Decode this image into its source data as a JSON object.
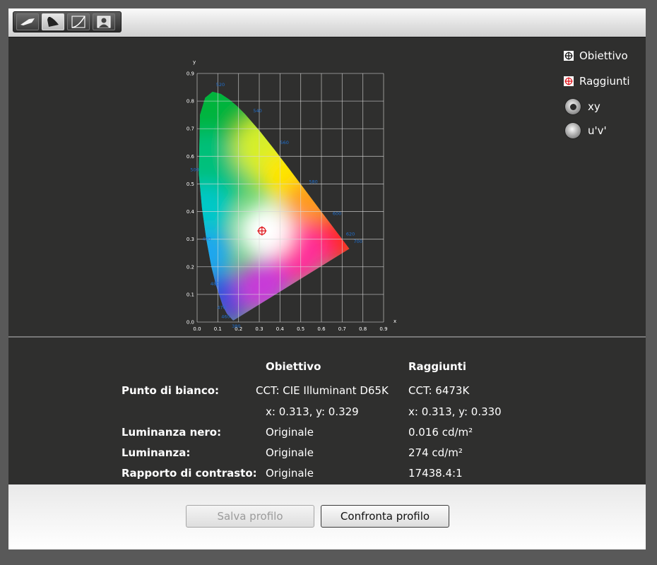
{
  "toolbar": {
    "tools": [
      {
        "name": "calibration-tool-icon",
        "active": false
      },
      {
        "name": "gamut-chart-icon",
        "active": true
      },
      {
        "name": "curve-icon",
        "active": false
      },
      {
        "name": "profile-user-icon",
        "active": false
      }
    ]
  },
  "legend": {
    "target_label": "Obiettivo",
    "achieved_label": "Raggiunti",
    "xy_label": "xy",
    "uv_label": "u'v'",
    "selected_mode": "xy",
    "achieved_color": "#e0161c"
  },
  "chart_data": {
    "type": "scatter",
    "title": "",
    "xlabel": "x",
    "ylabel": "y",
    "xlim": [
      0,
      0.9
    ],
    "ylim": [
      0,
      0.9
    ],
    "grid": true,
    "x_ticks": [
      "0.0",
      "0.1",
      "0.2",
      "0.3",
      "0.4",
      "0.5",
      "0.6",
      "0.7",
      "0.8",
      "0.9"
    ],
    "y_ticks": [
      "0.0",
      "0.1",
      "0.2",
      "0.3",
      "0.4",
      "0.5",
      "0.6",
      "0.7",
      "0.8",
      "0.9"
    ],
    "locus": [
      [
        0.1741,
        0.005
      ],
      [
        0.144,
        0.0297
      ],
      [
        0.1241,
        0.0578
      ],
      [
        0.0913,
        0.1327
      ],
      [
        0.0687,
        0.2007
      ],
      [
        0.0454,
        0.295
      ],
      [
        0.0235,
        0.4127
      ],
      [
        0.0082,
        0.5384
      ],
      [
        0.0139,
        0.7502
      ],
      [
        0.0389,
        0.812
      ],
      [
        0.0743,
        0.8338
      ],
      [
        0.1142,
        0.8262
      ],
      [
        0.1547,
        0.8059
      ],
      [
        0.1929,
        0.7816
      ],
      [
        0.2296,
        0.7543
      ],
      [
        0.3016,
        0.6923
      ],
      [
        0.3731,
        0.6245
      ],
      [
        0.4441,
        0.5547
      ],
      [
        0.5125,
        0.4866
      ],
      [
        0.5752,
        0.4242
      ],
      [
        0.627,
        0.3725
      ],
      [
        0.6658,
        0.334
      ],
      [
        0.6915,
        0.3083
      ],
      [
        0.7079,
        0.292
      ],
      [
        0.7347,
        0.2653
      ]
    ],
    "wavelength_labels": [
      {
        "text": "520",
        "x": 0.0743,
        "y": 0.8338
      },
      {
        "text": "540",
        "x": 0.2296,
        "y": 0.7543
      },
      {
        "text": "560",
        "x": 0.3731,
        "y": 0.6245
      },
      {
        "text": "580",
        "x": 0.5125,
        "y": 0.4866
      },
      {
        "text": "600",
        "x": 0.627,
        "y": 0.3725
      },
      {
        "text": "620",
        "x": 0.6915,
        "y": 0.3083
      },
      {
        "text": "700",
        "x": 0.7347,
        "y": 0.2653
      },
      {
        "text": "500",
        "x": 0.0082,
        "y": 0.5384
      },
      {
        "text": "490",
        "x": 0.0454,
        "y": 0.295
      },
      {
        "text": "480",
        "x": 0.0913,
        "y": 0.1327
      },
      {
        "text": "470",
        "x": 0.1241,
        "y": 0.0578
      },
      {
        "text": "460",
        "x": 0.144,
        "y": 0.0297
      },
      {
        "text": "380",
        "x": 0.1741,
        "y": 0.005
      }
    ],
    "points": [
      {
        "name": "Obiettivo",
        "x": 0.313,
        "y": 0.329
      },
      {
        "name": "Raggiunti",
        "x": 0.313,
        "y": 0.33
      }
    ]
  },
  "table": {
    "headers": {
      "target": "Obiettivo",
      "achieved": "Raggiunti"
    },
    "rows": [
      {
        "label": "Punto di bianco:",
        "target": "CCT: CIE Illuminant D65K",
        "achieved": "CCT: 6473K"
      },
      {
        "label": "",
        "target": "x: 0.313, y: 0.329",
        "achieved": "x: 0.313, y: 0.330"
      },
      {
        "label": "Luminanza nero:",
        "target": "Originale",
        "achieved": "0.016 cd/m²"
      },
      {
        "label": "Luminanza:",
        "target": "Originale",
        "achieved": "274 cd/m²"
      },
      {
        "label": "Rapporto di contrasto:",
        "target": "Originale",
        "achieved": "17438.4:1"
      }
    ]
  },
  "buttons": {
    "save_label": "Salva profilo",
    "compare_label": "Confronta profilo"
  }
}
